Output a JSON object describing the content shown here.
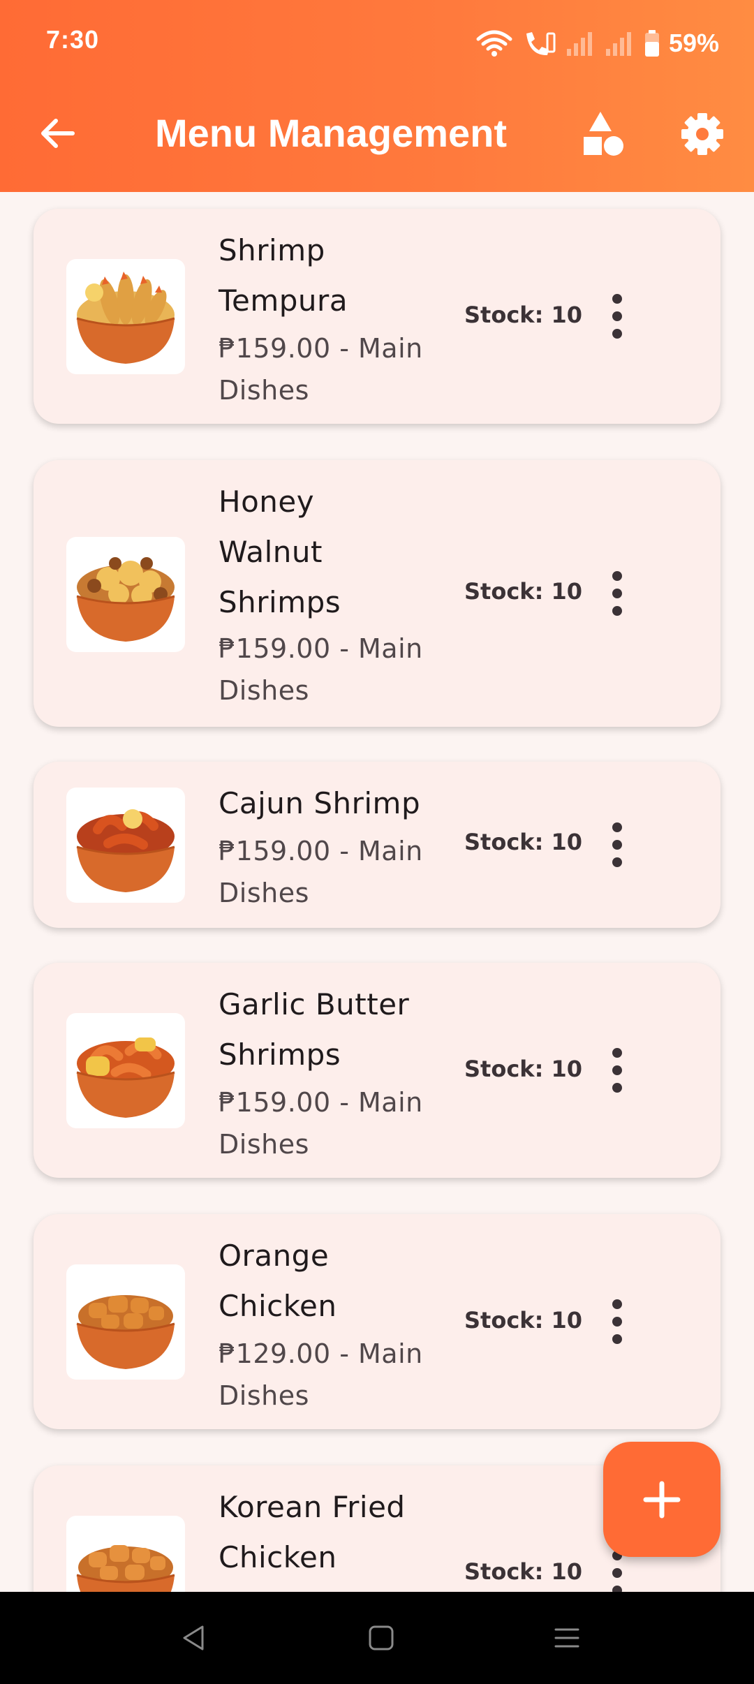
{
  "status_bar": {
    "time": "7:30",
    "battery": "59%",
    "icons": [
      "wifi-icon",
      "volte-call-icon",
      "signal-icon",
      "signal-icon",
      "battery-icon"
    ]
  },
  "app_bar": {
    "title": "Menu Management",
    "back_icon": "arrow-left-icon",
    "category_icon": "shapes-icon",
    "settings_icon": "gear-icon"
  },
  "menu_items": [
    {
      "name_lines": [
        "Shrimp",
        "Tempura"
      ],
      "price_lines": [
        "₱159.00 - Main",
        "Dishes"
      ],
      "stock": "Stock: 10",
      "image": "shrimp-tempura-image"
    },
    {
      "name_lines": [
        "Honey",
        "Walnut",
        "Shrimps"
      ],
      "price_lines": [
        "₱159.00 - Main",
        "Dishes"
      ],
      "stock": "Stock: 10",
      "image": "honey-walnut-shrimps-image"
    },
    {
      "name_lines": [
        "Cajun Shrimp"
      ],
      "price_lines": [
        "₱159.00 - Main",
        "Dishes"
      ],
      "stock": "Stock: 10",
      "image": "cajun-shrimp-image"
    },
    {
      "name_lines": [
        "Garlic Butter",
        "Shrimps"
      ],
      "price_lines": [
        "₱159.00 - Main",
        "Dishes"
      ],
      "stock": "Stock: 10",
      "image": "garlic-butter-shrimps-image"
    },
    {
      "name_lines": [
        "Orange",
        "Chicken"
      ],
      "price_lines": [
        "₱129.00 - Main",
        "Dishes"
      ],
      "stock": "Stock: 10",
      "image": "orange-chicken-image"
    },
    {
      "name_lines": [
        "Korean Fried",
        "Chicken"
      ],
      "price_lines": [],
      "stock": "Stock: 10",
      "image": "korean-fried-chicken-image"
    }
  ],
  "fab": {
    "icon": "plus-icon"
  },
  "nav_bar": {
    "icons": [
      "nav-back-icon",
      "nav-home-icon",
      "nav-recents-icon"
    ]
  },
  "colors": {
    "primary": "#ff6b35",
    "background": "#fcf4f2",
    "card": "#fdeeeb",
    "bowl": "#d86a2b"
  }
}
